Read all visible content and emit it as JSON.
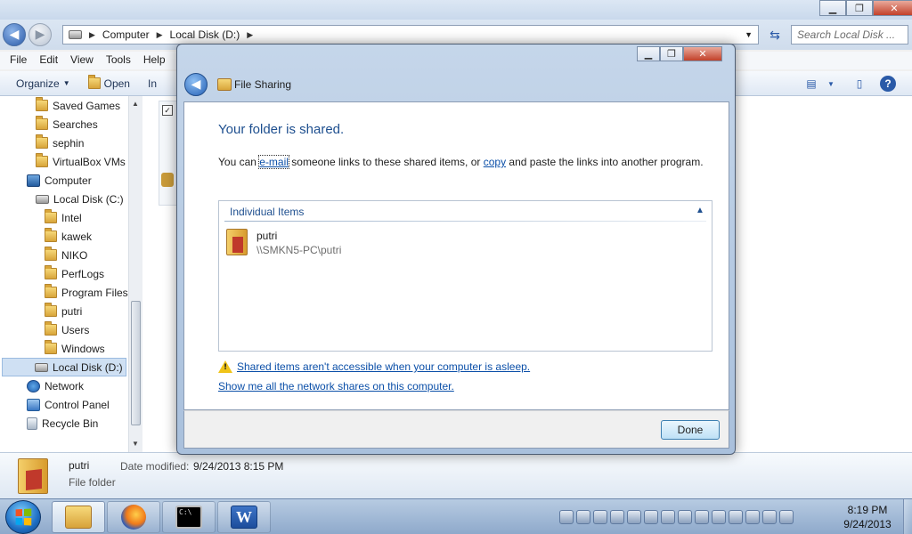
{
  "explorer": {
    "address": {
      "segments": [
        "Computer",
        "Local Disk (D:)"
      ]
    },
    "search_placeholder": "Search Local Disk ...",
    "menu": [
      "File",
      "Edit",
      "View",
      "Tools",
      "Help"
    ],
    "toolbar": {
      "organize": "Organize",
      "open": "Open",
      "truncated": "In"
    },
    "nav": {
      "items": [
        {
          "label": "Saved Games"
        },
        {
          "label": "Searches"
        },
        {
          "label": "sephin"
        },
        {
          "label": "VirtualBox VMs"
        },
        {
          "label": "Computer"
        },
        {
          "label": "Local Disk (C:)"
        },
        {
          "label": "Intel"
        },
        {
          "label": "kawek"
        },
        {
          "label": "NIKO"
        },
        {
          "label": "PerfLogs"
        },
        {
          "label": "Program Files"
        },
        {
          "label": "putri"
        },
        {
          "label": "Users"
        },
        {
          "label": "Windows"
        },
        {
          "label": "Local Disk (D:)"
        },
        {
          "label": "Network"
        },
        {
          "label": "Control Panel"
        },
        {
          "label": "Recycle Bin"
        }
      ]
    },
    "details": {
      "name": "putri",
      "modified_label": "Date modified:",
      "modified_value": "9/24/2013 8:15 PM",
      "type": "File folder"
    }
  },
  "dialog": {
    "title": "File Sharing",
    "heading": "Your folder is shared.",
    "instruction_pre": "You can ",
    "email_link": "e-mail",
    "instruction_mid": " someone links to these shared items, or ",
    "copy_link": "copy",
    "instruction_post": " and paste the links into another program.",
    "group_header": "Individual Items",
    "item": {
      "name": "putri",
      "path": "\\\\SMKN5-PC\\putri"
    },
    "warning_link": "Shared items aren't accessible when your computer is asleep.",
    "shares_link": "Show me all the network shares on this computer.",
    "done_button": "Done"
  },
  "taskbar": {
    "cmd_text": "C:\\",
    "word_letter": "W",
    "clock_time": "8:19 PM",
    "clock_date": "9/24/2013"
  },
  "icons": {
    "back": "back-arrow-icon",
    "forward": "forward-arrow-icon",
    "refresh": "refresh-icon",
    "folder": "folder-icon",
    "warning": "warning-icon"
  }
}
